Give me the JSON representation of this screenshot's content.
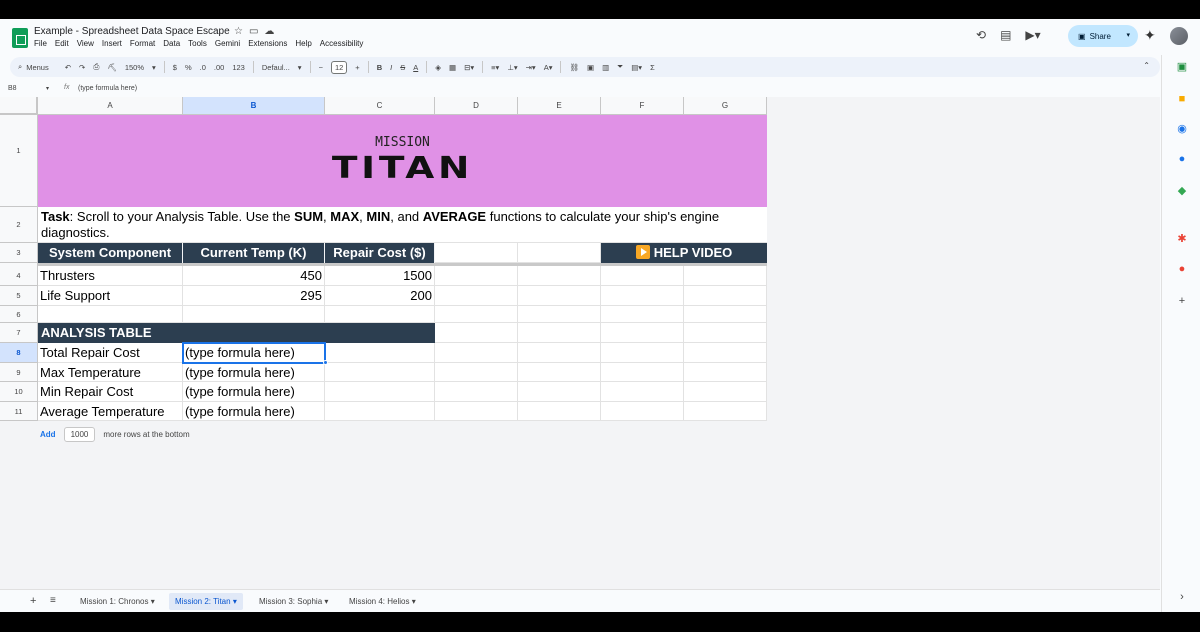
{
  "doc": {
    "title": "Example - Spreadsheet Data Space Escape",
    "menu": [
      "File",
      "Edit",
      "View",
      "Insert",
      "Format",
      "Data",
      "Tools",
      "Gemini",
      "Extensions",
      "Help",
      "Accessibility"
    ],
    "share_label": "Share"
  },
  "toolbar": {
    "menus_label": "Menus",
    "zoom": "150%",
    "currency": "$",
    "percent": "%",
    "dec_less": ".0",
    "dec_more": ".00",
    "number_format": "123",
    "font": "Defaul...",
    "font_size": "12",
    "bold": "B",
    "italic": "I",
    "strike": "S",
    "text_color": "A",
    "sum": "Σ"
  },
  "formula_bar": {
    "cell_ref": "B8",
    "fx": "fx",
    "content": "(type formula here)"
  },
  "columns": [
    "A",
    "B",
    "C",
    "D",
    "E",
    "F",
    "G"
  ],
  "rows": [
    "1",
    "2",
    "3",
    "4",
    "5",
    "6",
    "7",
    "8",
    "9",
    "10",
    "11"
  ],
  "banner": {
    "top": "MISSION",
    "title": "TITAN"
  },
  "task": {
    "label": "Task",
    "t1": ": Scroll to your Analysis Table. Use the ",
    "f1": "SUM",
    "t2": ", ",
    "f2": "MAX",
    "t3": ", ",
    "f3": "MIN",
    "t4": ", and ",
    "f4": "AVERAGE",
    "t5": " functions to calculate your ship's engine diagnostics."
  },
  "table": {
    "headers": [
      "System Component",
      "Current Temp (K)",
      "Repair Cost ($)"
    ],
    "help_video": "HELP VIDEO",
    "rows": [
      {
        "name": "Thrusters",
        "temp": "450",
        "cost": "1500"
      },
      {
        "name": "Life Support",
        "temp": "295",
        "cost": "200"
      }
    ]
  },
  "analysis": {
    "title": "ANALYSIS TABLE",
    "rows": [
      {
        "label": "Total Repair Cost",
        "value": "(type formula here)"
      },
      {
        "label": "Max Temperature",
        "value": "(type formula here)"
      },
      {
        "label": "Min Repair Cost",
        "value": "(type formula here)"
      },
      {
        "label": "Average Temperature",
        "value": "(type formula here)"
      }
    ]
  },
  "add_rows": {
    "add": "Add",
    "count": "1000",
    "suffix": "more rows at the bottom"
  },
  "sheets": [
    {
      "label": "Mission 1: Chronos",
      "active": false
    },
    {
      "label": "Mission 2: Titan",
      "active": true
    },
    {
      "label": "Mission 3: Sophia",
      "active": false
    },
    {
      "label": "Mission 4: Helios",
      "active": false
    }
  ],
  "colors": {
    "banner": "#e091e6",
    "header_bg": "#2c3e50",
    "selection": "#1a73e8",
    "sheets_green": "#0f9d58"
  }
}
